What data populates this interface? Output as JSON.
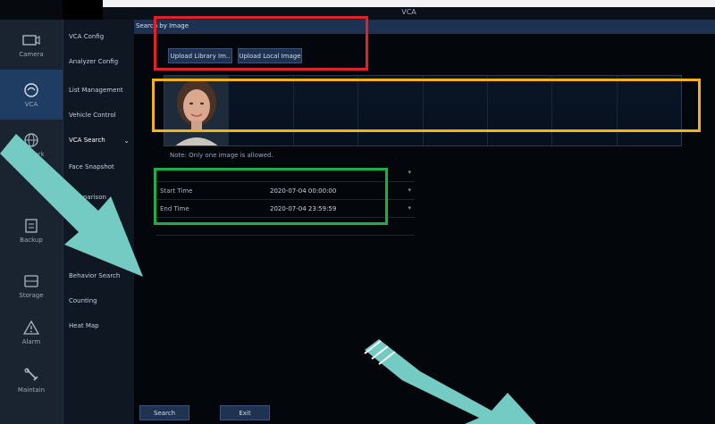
{
  "window": {
    "title": "VCA"
  },
  "rail": {
    "items": [
      {
        "label": "Camera",
        "icon": "camera-icon"
      },
      {
        "label": "VCA",
        "icon": "vca-icon",
        "active": true
      },
      {
        "label": "Network",
        "icon": "globe-icon"
      },
      {
        "label": "Backup",
        "icon": "backup-icon"
      },
      {
        "label": "Storage",
        "icon": "storage-icon"
      },
      {
        "label": "Alarm",
        "icon": "alarm-icon"
      },
      {
        "label": "Maintain",
        "icon": "wrench-icon"
      }
    ]
  },
  "submenu": {
    "items": [
      {
        "label": "VCA Config"
      },
      {
        "label": "Analyzer Config"
      },
      {
        "label": "List Management"
      },
      {
        "label": "Vehicle Control"
      },
      {
        "label": "VCA Search",
        "active": true,
        "chevron": "⌄"
      },
      {
        "label": "Face Snapshot"
      },
      {
        "label": "Comparison"
      },
      {
        "label": "Behavior Search"
      },
      {
        "label": "Counting"
      },
      {
        "label": "Heat Map"
      }
    ]
  },
  "main": {
    "tab": "Search by Image",
    "upload_library_button": "Upload Library Im..",
    "upload_local_button": "Upload Local Image",
    "note": "Note: Only one image is allowed.",
    "form": {
      "start_time_label": "Start Time",
      "start_time_value": "2020-07-04 00:00:00",
      "end_time_label": "End Time",
      "end_time_value": "2020-07-04 23:59:59"
    },
    "search_button": "Search",
    "exit_button": "Exit"
  },
  "colors": {
    "annotation_red": "#e0212a",
    "annotation_orange": "#f2b21a",
    "annotation_green": "#18b04b",
    "arrow_teal": "#74cbc3"
  }
}
